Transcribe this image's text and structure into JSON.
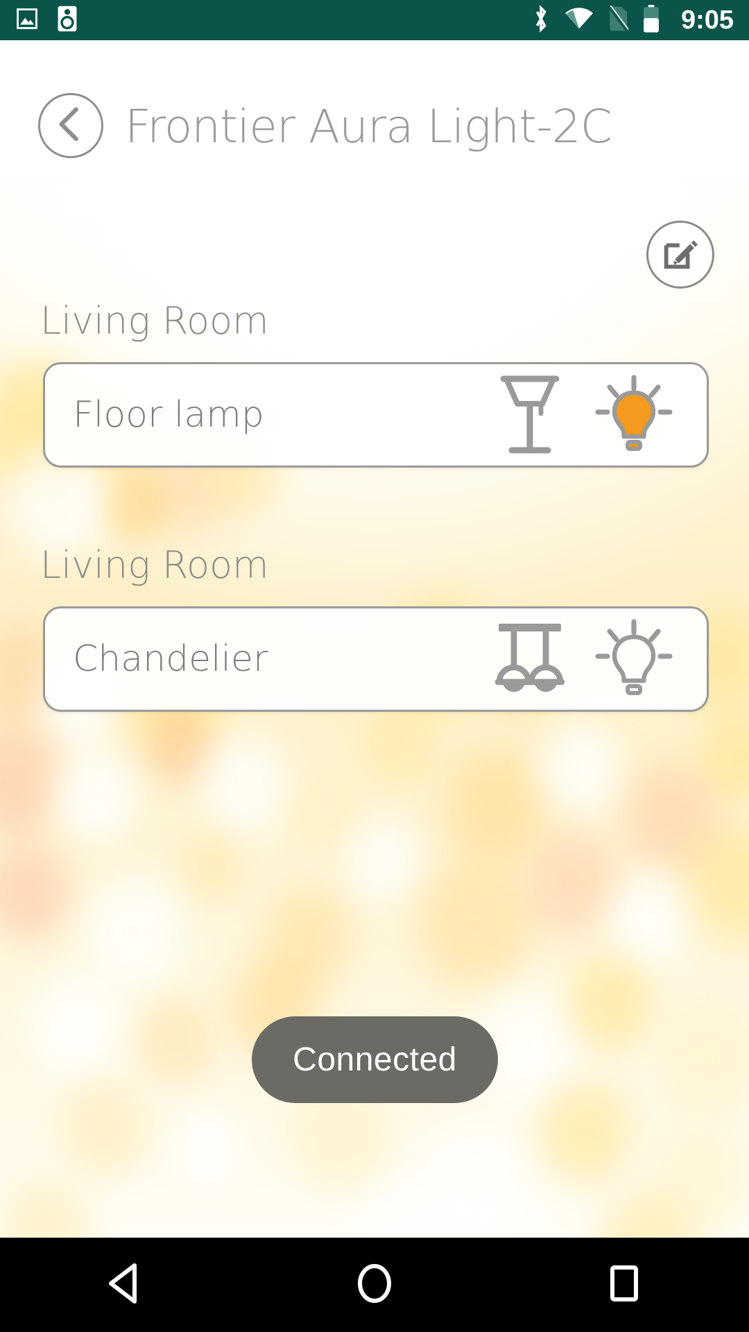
{
  "statusbar": {
    "time": "9:05",
    "left_icons": [
      {
        "name": "screenshot-icon",
        "label": "screenshot"
      },
      {
        "name": "speaker-icon",
        "label": "speaker"
      }
    ],
    "right_icons": [
      {
        "name": "bluetooth-icon",
        "label": "bluetooth"
      },
      {
        "name": "wifi-icon",
        "label": "wifi"
      },
      {
        "name": "no-sim-icon",
        "label": "no sim"
      },
      {
        "name": "battery-icon",
        "label": "battery"
      }
    ],
    "background_color": "#0a5449"
  },
  "header": {
    "title": "Frontier Aura Light-2C",
    "back_icon": "back-chevron-icon",
    "edit_icon": "edit-pencil-icon"
  },
  "groups": [
    {
      "room": "Living Room",
      "device_name": "Floor lamp",
      "device_icon": "floor-lamp-icon",
      "bulb_icon": "bulb-on-icon",
      "bulb_state": "on",
      "bulb_color": "#f49a1e"
    },
    {
      "room": "Living Room",
      "device_name": "Chandelier",
      "device_icon": "chandelier-icon",
      "bulb_icon": "bulb-off-icon",
      "bulb_state": "off",
      "bulb_color": "#9a9a9a"
    }
  ],
  "status_button": {
    "label": "Connected",
    "background_color": "#6b6b66",
    "text_color": "#ffffff"
  },
  "navbar": {
    "back": "back-triangle-icon",
    "home": "home-circle-icon",
    "recents": "recents-square-icon"
  },
  "theme": {
    "accent": "#f49a1e",
    "statusbar": "#0a5449",
    "outline": "#9a9a9a",
    "text_muted": "#8f8f86"
  }
}
